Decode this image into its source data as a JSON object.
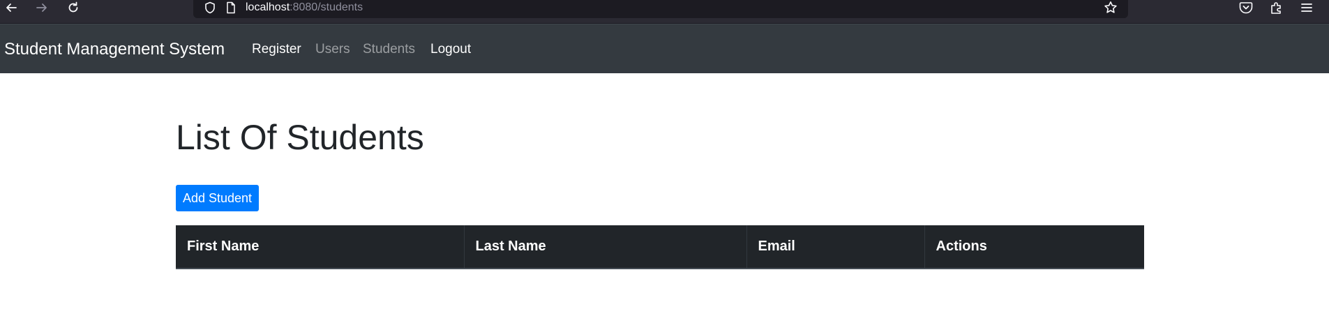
{
  "browser": {
    "url_host": "localhost",
    "url_rest": ":8080/students"
  },
  "navbar": {
    "brand": "Student Management System",
    "links": [
      {
        "label": "Register"
      },
      {
        "label": "Users"
      },
      {
        "label": "Students"
      },
      {
        "label": "Logout"
      }
    ]
  },
  "main": {
    "title": "List Of Students",
    "add_button_label": "Add Student",
    "table": {
      "columns": [
        "First Name",
        "Last Name",
        "Email",
        "Actions"
      ],
      "rows": []
    }
  },
  "colors": {
    "navbar_bg": "#343a40",
    "primary": "#007bff",
    "table_header_bg": "#212529"
  }
}
